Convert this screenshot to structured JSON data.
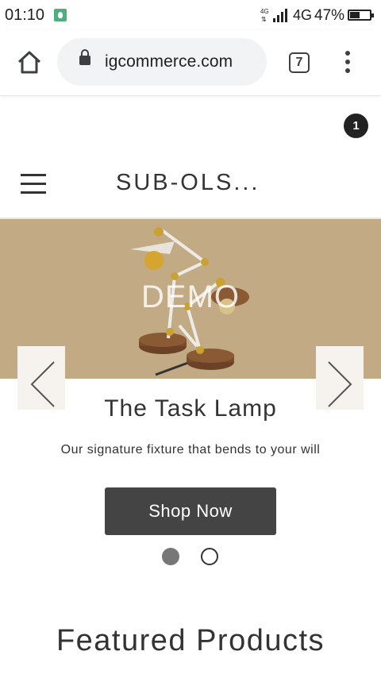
{
  "status_bar": {
    "time": "01:10",
    "network": "4G",
    "battery": "47%"
  },
  "browser": {
    "url": "igcommerce.com",
    "tab_count": "7"
  },
  "header": {
    "cart_count": "1",
    "site_title": "SUB-OLS..."
  },
  "slideshow": {
    "watermark": "DEMO",
    "heading": "The Task Lamp",
    "subheading": "Our signature fixture that bends to your will",
    "button_label": "Shop Now",
    "slide_count": 2,
    "active_slide": 1
  },
  "featured": {
    "title": "Featured Products"
  },
  "colors": {
    "hero_bg": "#c2aa85",
    "button_bg": "#444444",
    "text": "#333333"
  }
}
